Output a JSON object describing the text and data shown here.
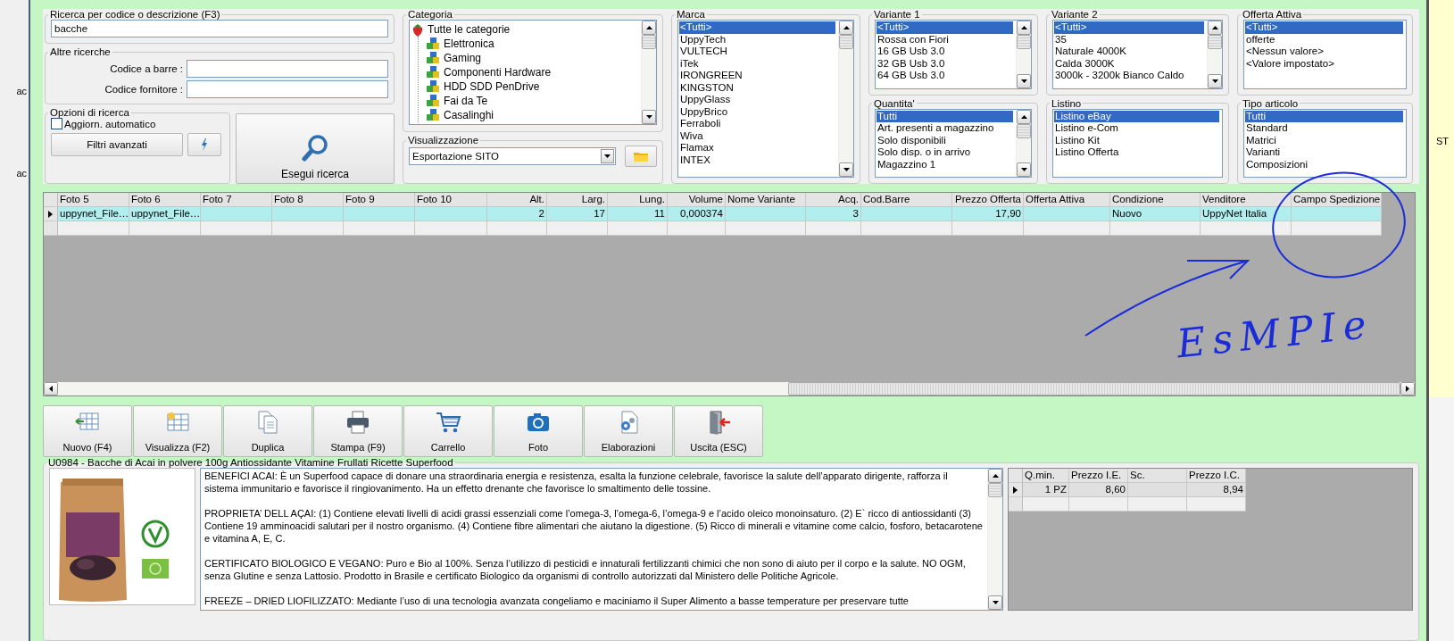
{
  "side_labels": [
    "ac",
    "ac"
  ],
  "right_label": "ST",
  "search": {
    "title": "Ricerca per codice o descrizione (F3)",
    "value": "bacche"
  },
  "other_searches": {
    "title": "Altre ricerche",
    "fields": [
      {
        "label": "Codice a barre :"
      },
      {
        "label": "Codice fornitore :"
      }
    ]
  },
  "search_options": {
    "title": "Opzioni di ricerca",
    "auto_update": {
      "label": "Aggiorn. automatico",
      "checked": false
    },
    "advanced_filters": "Filtri avanzati"
  },
  "search_button": "Esegui ricerca",
  "category": {
    "title": "Categoria",
    "root": {
      "label": "Tutte le categorie",
      "children": [
        {
          "label": "Elettronica"
        },
        {
          "label": "Gaming"
        },
        {
          "label": "Componenti Hardware"
        },
        {
          "label": "HDD SDD PenDrive"
        },
        {
          "label": "Fai da Te"
        },
        {
          "label": "Casalinghi"
        }
      ]
    }
  },
  "view": {
    "title": "Visualizzazione",
    "value": "Esportazione SITO"
  },
  "filter_columns": [
    {
      "groups": [
        {
          "title": "Marca",
          "kind": "scroll",
          "items": [
            {
              "label": "<Tutti>",
              "selected": true
            },
            {
              "label": "UppyTech",
              "selected": false
            },
            {
              "label": "VULTECH",
              "selected": false
            },
            {
              "label": "iTek",
              "selected": false
            },
            {
              "label": "IRONGREEN",
              "selected": false
            },
            {
              "label": "KINGSTON",
              "selected": false
            },
            {
              "label": "UppyGlass",
              "selected": false
            },
            {
              "label": "UppyBrico",
              "selected": false
            },
            {
              "label": "Ferraboli",
              "selected": false
            },
            {
              "label": "Wiva",
              "selected": false
            },
            {
              "label": "Flamax",
              "selected": false
            },
            {
              "label": "INTEX",
              "selected": false
            }
          ]
        }
      ]
    },
    {
      "groups": [
        {
          "title": "Variante 1",
          "kind": "scroll",
          "items": [
            {
              "label": "<Tutti>",
              "selected": true
            },
            {
              "label": "Rossa con Fiori",
              "selected": false
            },
            {
              "label": "16 GB Usb 3.0",
              "selected": false
            },
            {
              "label": "32 GB Usb 3.0",
              "selected": false
            },
            {
              "label": "64 GB Usb 3.0",
              "selected": false
            }
          ]
        },
        {
          "title": "Quantita'",
          "kind": "scroll",
          "items": [
            {
              "label": "Tutti",
              "selected": true
            },
            {
              "label": "Art. presenti a magazzino",
              "selected": false
            },
            {
              "label": "Solo disponibili",
              "selected": false
            },
            {
              "label": "Solo disp. o in arrivo",
              "selected": false
            },
            {
              "label": "Magazzino 1",
              "selected": false
            }
          ]
        }
      ]
    },
    {
      "groups": [
        {
          "title": "Variante 2",
          "kind": "scroll",
          "items": [
            {
              "label": "<Tutti>",
              "selected": true
            },
            {
              "label": "35",
              "selected": false
            },
            {
              "label": "Naturale 4000K",
              "selected": false
            },
            {
              "label": "Calda 3000K",
              "selected": false
            },
            {
              "label": "3000k - 3200k Bianco Caldo",
              "selected": false
            }
          ]
        },
        {
          "title": "Listino",
          "kind": "plain",
          "items": [
            {
              "label": "Listino eBay",
              "selected": true
            },
            {
              "label": "Listino e-Com",
              "selected": false
            },
            {
              "label": "Listino Kit",
              "selected": false
            },
            {
              "label": "Listino Offerta",
              "selected": false
            }
          ]
        }
      ]
    },
    {
      "groups": [
        {
          "title": "Offerta Attiva",
          "kind": "plain",
          "items": [
            {
              "label": "<Tutti>",
              "selected": true
            },
            {
              "label": "offerte",
              "selected": false
            },
            {
              "label": "<Nessun valore>",
              "selected": false
            },
            {
              "label": "<Valore impostato>",
              "selected": false
            }
          ]
        },
        {
          "title": "Tipo articolo",
          "kind": "plain",
          "items": [
            {
              "label": "Tutti",
              "selected": true
            },
            {
              "label": "Standard",
              "selected": false
            },
            {
              "label": "Matrici",
              "selected": false
            },
            {
              "label": "Varianti",
              "selected": false
            },
            {
              "label": "Composizioni",
              "selected": false
            }
          ]
        }
      ]
    }
  ],
  "grid": {
    "columns": [
      {
        "label": "Foto 5",
        "kind": "text"
      },
      {
        "label": "Foto 6",
        "kind": "text"
      },
      {
        "label": "Foto 7",
        "kind": "text"
      },
      {
        "label": "Foto 8",
        "kind": "text"
      },
      {
        "label": "Foto 9",
        "kind": "text"
      },
      {
        "label": "Foto 10",
        "kind": "text"
      },
      {
        "label": "Alt.",
        "kind": "number"
      },
      {
        "label": "Larg.",
        "kind": "number"
      },
      {
        "label": "Lung.",
        "kind": "number"
      },
      {
        "label": "Volume",
        "kind": "number"
      },
      {
        "label": "Nome Variante",
        "kind": "text"
      },
      {
        "label": "Acq.",
        "kind": "number"
      },
      {
        "label": "Cod.Barre",
        "kind": "text"
      },
      {
        "label": "Prezzo Offerta",
        "kind": "number"
      },
      {
        "label": "Offerta Attiva",
        "kind": "text"
      },
      {
        "label": "Condizione",
        "kind": "text"
      },
      {
        "label": "Venditore",
        "kind": "text"
      },
      {
        "label": "Campo Spedizione",
        "kind": "text"
      }
    ],
    "rows": [
      {
        "selected": true,
        "cells": [
          "uppynet_File…",
          "uppynet_File…",
          "",
          "",
          "",
          "",
          "2",
          "17",
          "11",
          "0,000374",
          "",
          "3",
          "",
          "17,90",
          "",
          "Nuovo",
          "UppyNet Italia",
          ""
        ]
      }
    ]
  },
  "toolbar": [
    {
      "label": "Nuovo (F4)",
      "kind": "new"
    },
    {
      "label": "Visualizza (F2)",
      "kind": "view"
    },
    {
      "label": "Duplica",
      "kind": "duplicate"
    },
    {
      "label": "Stampa (F9)",
      "kind": "print"
    },
    {
      "label": "Carrello",
      "kind": "cart"
    },
    {
      "label": "Foto",
      "kind": "camera"
    },
    {
      "label": "Elaborazioni",
      "kind": "process"
    },
    {
      "label": "Uscita (ESC)",
      "kind": "exit"
    }
  ],
  "product": {
    "title": "U0984 - Bacche di Acai in polvere 100g Antiossidante Vitamine Frullati Ricette Superfood",
    "image": {
      "kind": "picture"
    },
    "description": [
      "BENEFICI ACAI: È un Superfood capace di donare una straordinaria energia e resistenza, esalta la funzione celebrale, favorisce la salute dell’apparato dirigente, rafforza il sistema immunitario e favorisce il ringiovanimento. Ha un effetto drenante che favorisce lo smaltimento delle tossine.",
      "PROPRIETA’ DELL AÇAI: (1) Contiene elevati livelli di acidi grassi essenziali come l’omega-3, l’omega-6, l’omega-9 e l’acido oleico monoinsaturo. (2) E` ricco di antiossidanti (3) Contiene 19 amminoacidi salutari per il nostro organismo. (4) Contiene fibre alimentari che aiutano la digestione. (5) Ricco di minerali e vitamine come calcio, fosforo, betacarotene e vitamina A, E, C.",
      "CERTIFICATO BIOLOGICO E VEGANO: Puro e Bio al 100%. Senza l’utilizzo di pesticidi e innaturali fertilizzanti chimici che non sono di aiuto per il corpo e la salute. NO OGM, senza Glutine e senza Lattosio. Prodotto in Brasile e certificato Biologico da organismi di controllo autorizzati dal Ministero delle Politiche Agricole.",
      "FREEZE – DRIED LIOFILIZZATO: Mediante l’uso di una tecnologia avanzata congeliamo e maciniamo il Super Alimento a basse temperature per preservare tutte"
    ],
    "price_grid": {
      "columns": [
        {
          "label": "Q.min.",
          "kind": "number"
        },
        {
          "label": "Prezzo I.E.",
          "kind": "number"
        },
        {
          "label": "Sc.",
          "kind": "number"
        },
        {
          "label": "Prezzo I.C.",
          "kind": "number"
        }
      ],
      "rows": [
        {
          "selected": true,
          "cells": [
            "1 PZ",
            "8,60",
            "",
            "8,94"
          ]
        }
      ]
    }
  },
  "annotation": {
    "text": "EsMPIe"
  }
}
